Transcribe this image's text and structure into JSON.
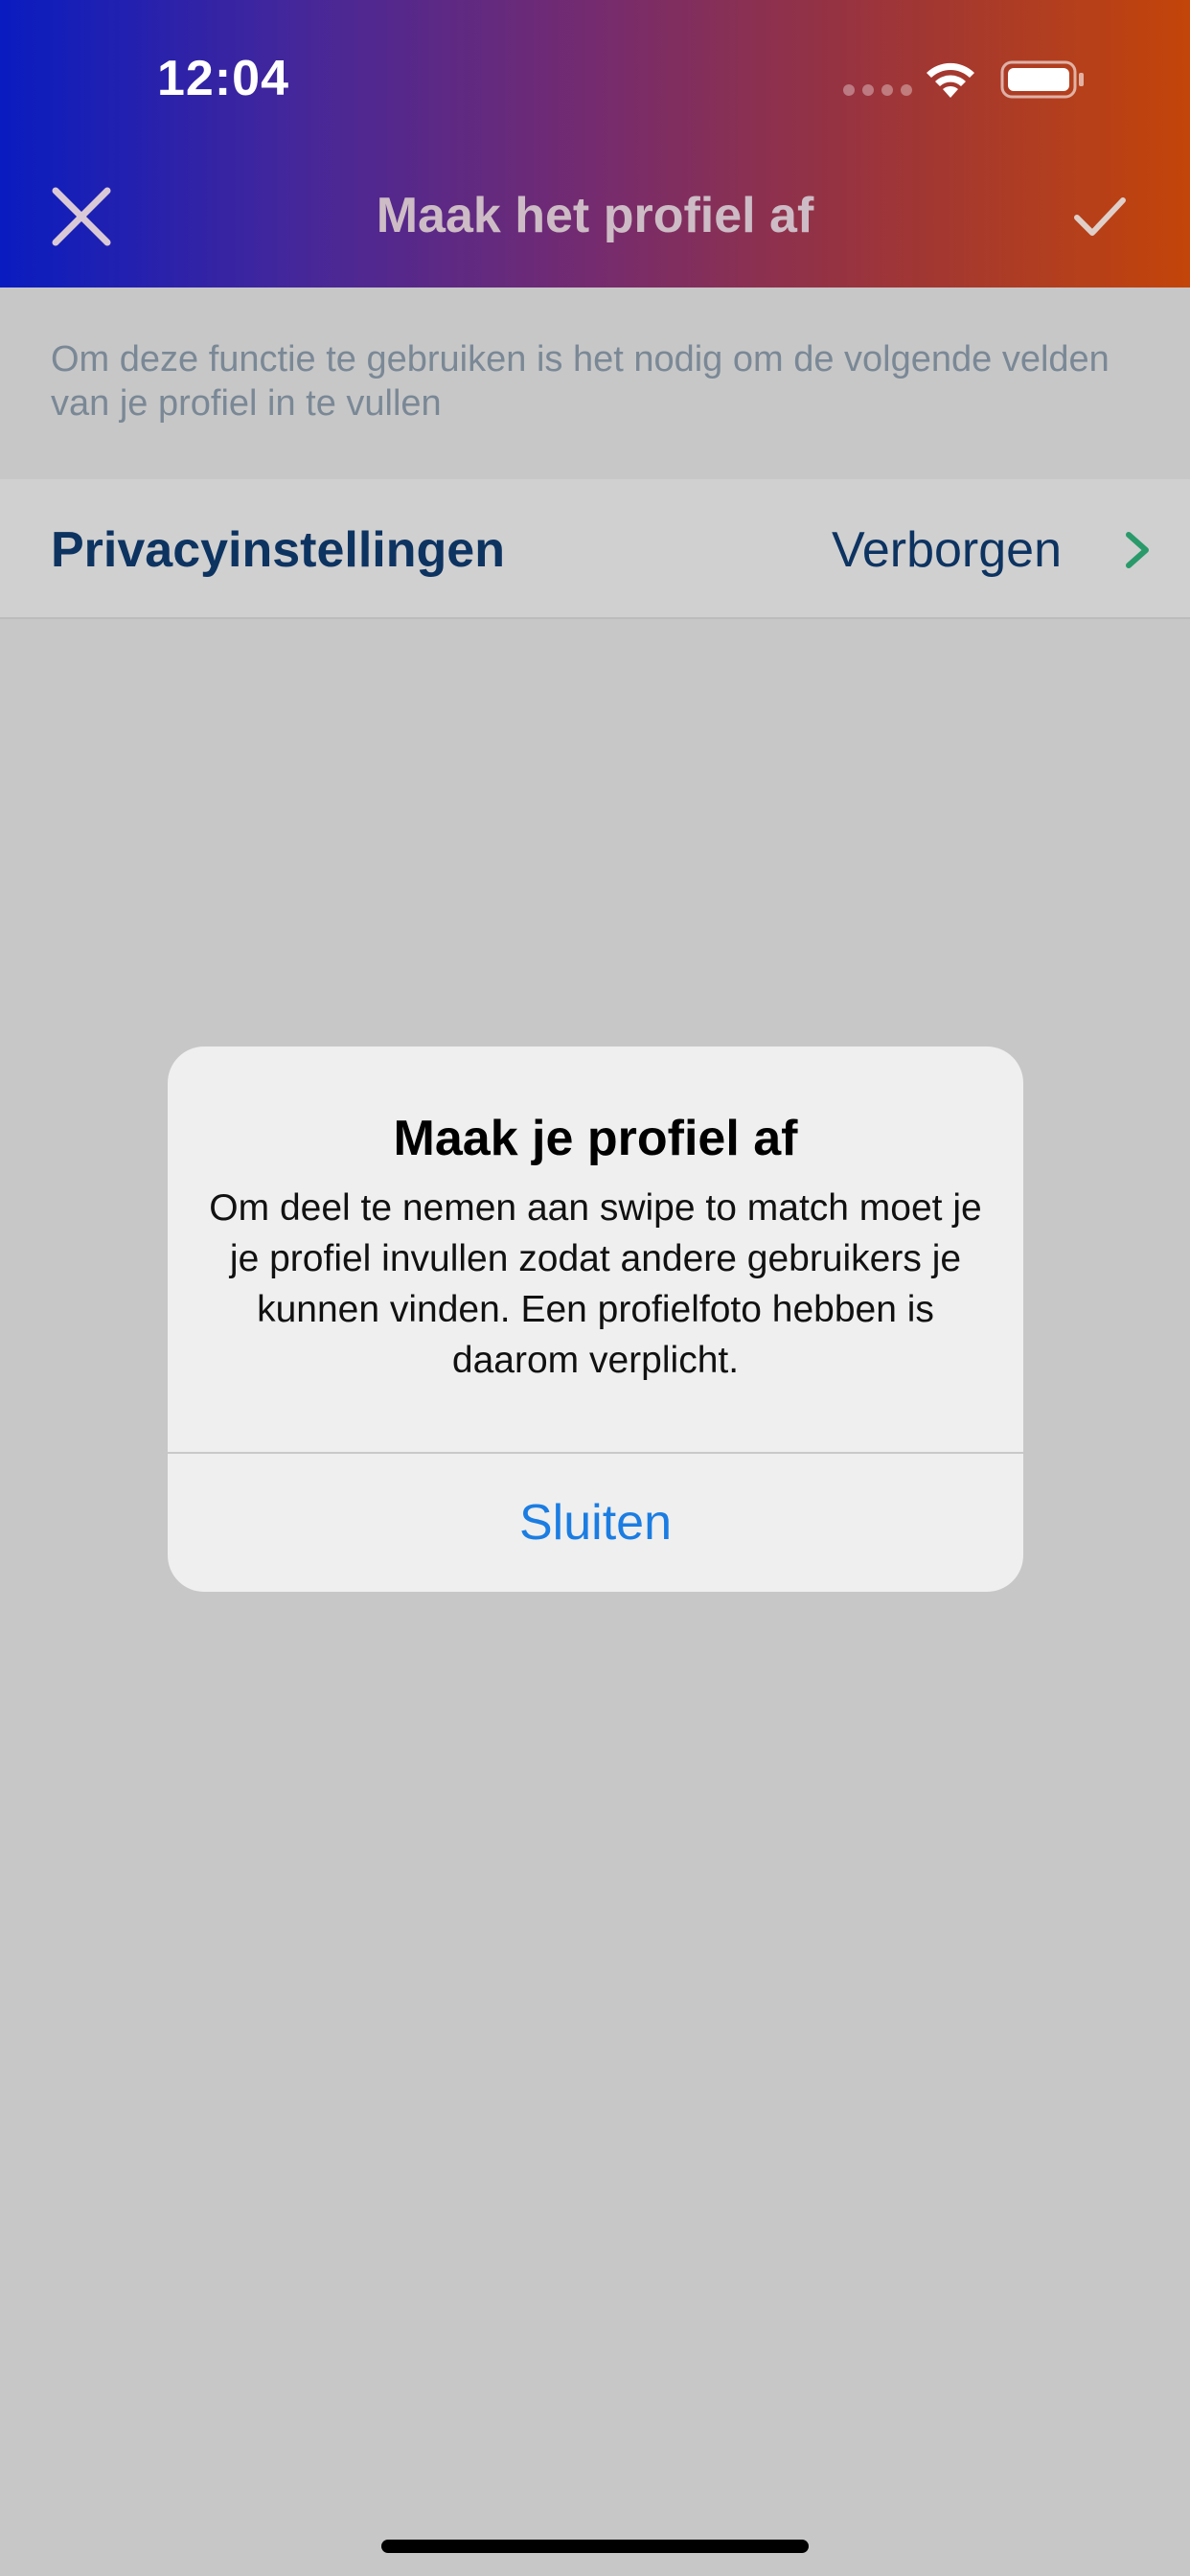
{
  "status_bar": {
    "time": "12:04"
  },
  "nav": {
    "title": "Maak het profiel af",
    "close_icon": "close-icon",
    "confirm_icon": "checkmark-icon"
  },
  "info": {
    "text": "Om deze functie te gebruiken is het nodig om de volgende velden van je profiel in te vullen"
  },
  "privacy_row": {
    "label": "Privacyinstellingen",
    "value": "Verborgen",
    "chevron_icon": "chevron-right-icon"
  },
  "alert": {
    "title": "Maak je profiel af",
    "message": "Om deel te nemen aan swipe to match moet je je profiel invullen zodat andere gebruikers je kunnen vinden. Een profielfoto hebben is daarom verplicht.",
    "button_label": "Sluiten"
  },
  "colors": {
    "gradient_start": "#0a1ecc",
    "gradient_end": "#d04a0a",
    "link_blue": "#1b7de2",
    "row_text": "#0d3361",
    "chevron_green": "#2a9a6a"
  }
}
